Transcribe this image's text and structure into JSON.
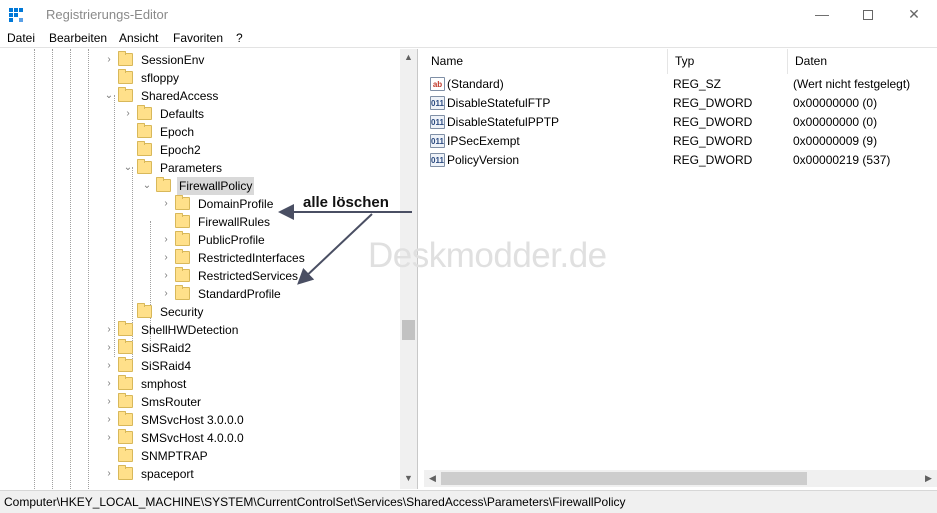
{
  "window": {
    "title": "Registrierungs-Editor"
  },
  "menu": [
    "Datei",
    "Bearbeiten",
    "Ansicht",
    "Favoriten",
    "?"
  ],
  "tree": [
    {
      "label": "SessionEnv",
      "level": 0,
      "toggle": "›"
    },
    {
      "label": "sfloppy",
      "level": 0,
      "toggle": ""
    },
    {
      "label": "SharedAccess",
      "level": 0,
      "toggle": "⌄"
    },
    {
      "label": "Defaults",
      "level": 1,
      "toggle": "›"
    },
    {
      "label": "Epoch",
      "level": 1,
      "toggle": ""
    },
    {
      "label": "Epoch2",
      "level": 1,
      "toggle": ""
    },
    {
      "label": "Parameters",
      "level": 1,
      "toggle": "⌄"
    },
    {
      "label": "FirewallPolicy",
      "level": 2,
      "toggle": "⌄",
      "selected": true
    },
    {
      "label": "DomainProfile",
      "level": 3,
      "toggle": "›"
    },
    {
      "label": "FirewallRules",
      "level": 3,
      "toggle": ""
    },
    {
      "label": "PublicProfile",
      "level": 3,
      "toggle": "›"
    },
    {
      "label": "RestrictedInterfaces",
      "level": 3,
      "toggle": "›"
    },
    {
      "label": "RestrictedServices",
      "level": 3,
      "toggle": "›"
    },
    {
      "label": "StandardProfile",
      "level": 3,
      "toggle": "›"
    },
    {
      "label": "Security",
      "level": 1,
      "toggle": ""
    },
    {
      "label": "ShellHWDetection",
      "level": 0,
      "toggle": "›"
    },
    {
      "label": "SiSRaid2",
      "level": 0,
      "toggle": "›"
    },
    {
      "label": "SiSRaid4",
      "level": 0,
      "toggle": "›"
    },
    {
      "label": "smphost",
      "level": 0,
      "toggle": "›"
    },
    {
      "label": "SmsRouter",
      "level": 0,
      "toggle": "›"
    },
    {
      "label": "SMSvcHost 3.0.0.0",
      "level": 0,
      "toggle": "›"
    },
    {
      "label": "SMSvcHost 4.0.0.0",
      "level": 0,
      "toggle": "›"
    },
    {
      "label": "SNMPTRAP",
      "level": 0,
      "toggle": ""
    },
    {
      "label": "spaceport",
      "level": 0,
      "toggle": "›"
    }
  ],
  "columns": [
    "Name",
    "Typ",
    "Daten"
  ],
  "values": [
    {
      "icon": "ab",
      "name": "(Standard)",
      "type": "REG_SZ",
      "data": "(Wert nicht festgelegt)"
    },
    {
      "icon": "011",
      "name": "DisableStatefulFTP",
      "type": "REG_DWORD",
      "data": "0x00000000 (0)"
    },
    {
      "icon": "011",
      "name": "DisableStatefulPPTP",
      "type": "REG_DWORD",
      "data": "0x00000000 (0)"
    },
    {
      "icon": "011",
      "name": "IPSecExempt",
      "type": "REG_DWORD",
      "data": "0x00000009 (9)"
    },
    {
      "icon": "011",
      "name": "PolicyVersion",
      "type": "REG_DWORD",
      "data": "0x00000219 (537)"
    }
  ],
  "status_path": "Computer\\HKEY_LOCAL_MACHINE\\SYSTEM\\CurrentControlSet\\Services\\SharedAccess\\Parameters\\FirewallPolicy",
  "annotation": "alle löschen",
  "watermark": "Deskmodder.de",
  "colors": {
    "folder": "#ffe08a",
    "selection": "#d9d9d9",
    "arrow": "#4a4f63",
    "accent": "#0078d7"
  }
}
